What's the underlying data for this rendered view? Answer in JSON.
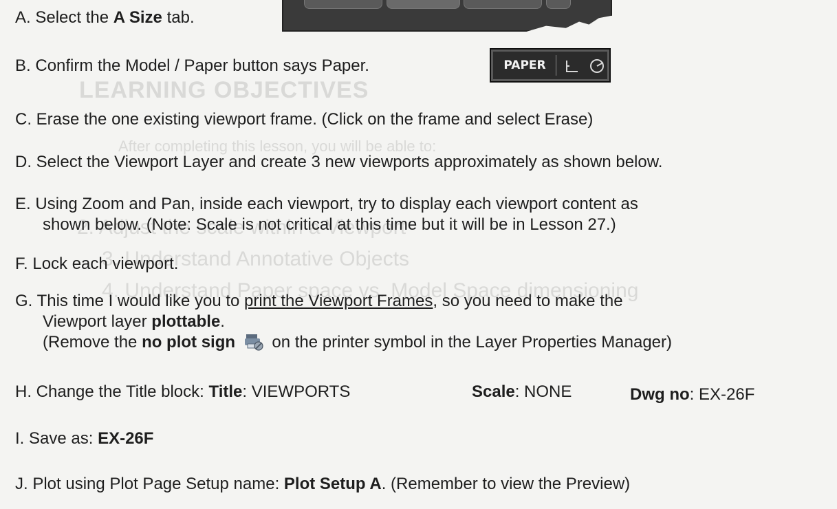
{
  "tabbar": {
    "tabs": [
      "",
      "",
      "",
      ""
    ]
  },
  "status_widget": {
    "paper_label": "PAPER",
    "ortho_icon": "ortho-icon",
    "polar_icon": "polar-tracking-icon"
  },
  "ghost": {
    "heading": "LEARNING OBJECTIVES",
    "line1": "After completing this lesson, you will be able to:",
    "line2": "2. Adjust the scale within a Viewport",
    "line3": "3. Understand Annotative Objects",
    "line4": "4. Understand Paper space vs. Model Space dimensioning"
  },
  "steps": {
    "a": {
      "letter": "A.",
      "pre": "Select the ",
      "bold": "A Size",
      "post": "  tab."
    },
    "b": {
      "letter": "B.",
      "text": "Confirm the Model / Paper button says Paper."
    },
    "c": {
      "letter": "C.",
      "text": "Erase the one existing viewport frame.  (Click on the frame and select Erase)"
    },
    "d": {
      "letter": "D.",
      "text": "Select the Viewport Layer and create 3 new viewports approximately as shown below."
    },
    "e": {
      "letter": "E.",
      "line1": "Using Zoom and Pan, inside each viewport,  try to display each viewport content as",
      "line2": "shown below.  (Note: Scale is not critical at this time but it will be in Lesson 27.)"
    },
    "f": {
      "letter": "F.",
      "text": "Lock each viewport."
    },
    "g": {
      "letter": "G.",
      "line1_pre": "This time I would like you to ",
      "line1_link": "print the Viewport Frames",
      "line1_post": ", so you need to make the",
      "line2_pre": "Viewport layer ",
      "line2_bold": "plottable",
      "line2_post": ".",
      "line3_pre": "(Remove the ",
      "line3_bold": "no plot sign",
      "line3_icon": "no-plot-printer-icon",
      "line3_post": "on the printer symbol in the Layer Properties Manager)"
    },
    "h": {
      "letter": "H.",
      "pre": "Change the Title block: ",
      "title_label": "Title",
      "title_value": ":  VIEWPORTS",
      "scale_label": "Scale",
      "scale_value": ": NONE",
      "dwg_label": "Dwg no",
      "dwg_value": ":  EX-26F"
    },
    "i": {
      "letter": "I.",
      "pre": "Save as:  ",
      "bold": "EX-26F"
    },
    "j": {
      "letter": "J.",
      "pre": "Plot using Plot Page Setup name: ",
      "bold": "Plot Setup A",
      "post": ".  (Remember to view the Preview)"
    }
  }
}
